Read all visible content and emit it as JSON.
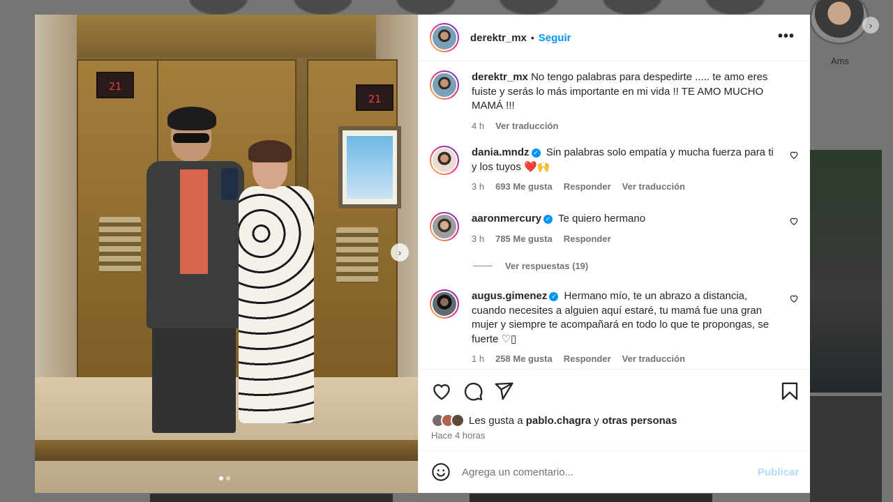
{
  "background": {
    "story_label": "Ams"
  },
  "post": {
    "author": "derektr_mx",
    "separator": "•",
    "follow_label": "Seguir",
    "more_icon": "more-icon",
    "elevator_display": "21",
    "carousel": {
      "current": 1,
      "total": 2
    }
  },
  "comments": [
    {
      "user": "derektr_mx",
      "verified": false,
      "text": "No tengo palabras para despedirte ..... te amo eres fuiste y serás lo más importante en mi vida !! TE AMO MUCHO MAMÁ !!!",
      "time": "4 h",
      "likes": "",
      "reply": "",
      "translate": "Ver traducción"
    },
    {
      "user": "dania.mndz",
      "verified": true,
      "text": "Sin palabras solo empatía y mucha fuerza para ti y los tuyos",
      "emoji": "❤️🙌",
      "time": "3 h",
      "likes": "693 Me gusta",
      "reply": "Responder",
      "translate": "Ver traducción"
    },
    {
      "user": "aaronmercury",
      "verified": true,
      "text": "Te quiero hermano",
      "time": "3 h",
      "likes": "785 Me gusta",
      "reply": "Responder",
      "translate": ""
    },
    {
      "user": "augus.gimenez",
      "verified": true,
      "text": "Hermano mío, te un abrazo a distancia, cuando necesites a alguien aquí estaré, tu mamá fue una gran mujer y siempre te acompañará en todo lo que te propongas, se fuerte",
      "emoji": "♡▯",
      "time": "1 h",
      "likes": "258 Me gusta",
      "reply": "Responder",
      "translate": "Ver traducción"
    }
  ],
  "replies_label": "Ver respuestas (19)",
  "likes_summary": {
    "prefix": "Les gusta a",
    "user": "pablo.chagra",
    "connector": "y",
    "others": "otras personas"
  },
  "time_ago": "Hace 4 horas",
  "composer": {
    "placeholder": "Agrega un comentario...",
    "publish_label": "Publicar"
  },
  "icons": {
    "like": "heart-icon",
    "comment": "comment-icon",
    "share": "send-icon",
    "save": "bookmark-icon",
    "emoji": "emoji-icon",
    "next": "chevron-right-icon"
  },
  "colors": {
    "link_blue": "#0095f6",
    "disabled_blue": "#b3dbff",
    "text": "#262626",
    "muted": "#737373",
    "overlay": "#757575"
  }
}
